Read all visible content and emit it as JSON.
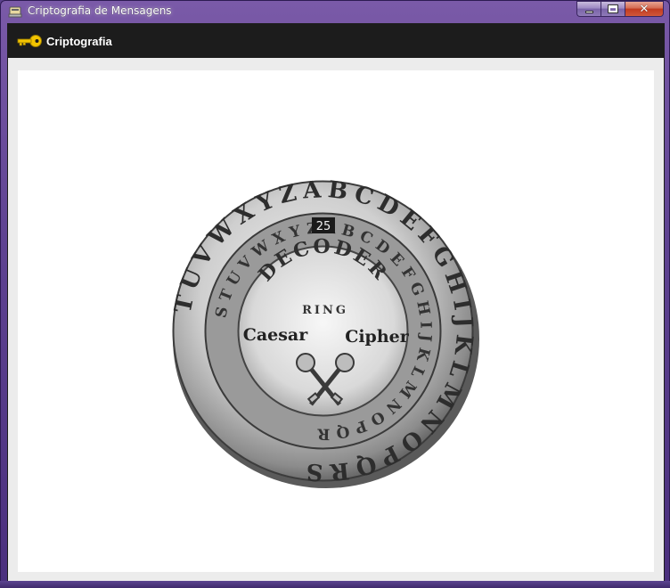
{
  "window": {
    "title": "Criptografia de Mensagens",
    "minimize_label": "",
    "maximize_label": "",
    "close_label": "✕"
  },
  "appbar": {
    "title": "Criptografia",
    "icon": "key-icon",
    "icon_color": "#f2c400"
  },
  "image": {
    "description_icon": "decoder-ring-image",
    "outer_ring_letters": "TUVWXYZABCDEFGHIJKLMNOPQRS",
    "inner_ring_letters": "STUVWXYZABCDEFGHIJKLMNOPQR",
    "top_label": "DECODER",
    "sub_label": "RING",
    "left_label": "Caesar",
    "right_label": "Cipher",
    "shift_number": "25"
  },
  "colors": {
    "frame": "#5f4392",
    "appbar": "#1c1c1c",
    "content_bg": "#ffffff",
    "client_bg": "#ececec"
  }
}
